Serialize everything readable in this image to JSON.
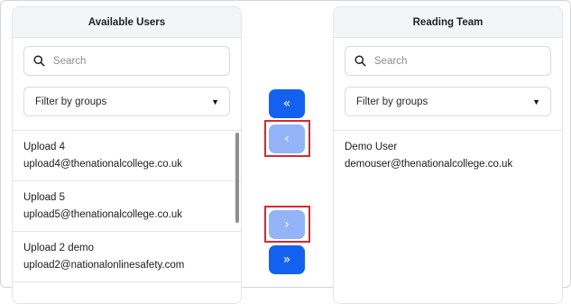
{
  "left_panel": {
    "title": "Available Users",
    "search_placeholder": "Search",
    "filter_label": "Filter by groups",
    "users": [
      {
        "name": "Upload 4",
        "email": "upload4@thenationalcollege.co.uk"
      },
      {
        "name": "Upload 5",
        "email": "upload5@thenationalcollege.co.uk"
      },
      {
        "name": "Upload 2 demo",
        "email": "upload2@nationalonlinesafety.com"
      }
    ]
  },
  "right_panel": {
    "title": "Reading Team",
    "search_placeholder": "Search",
    "filter_label": "Filter by groups",
    "users": [
      {
        "name": "Demo User",
        "email": "demouser@thenationalcollege.co.uk"
      }
    ]
  },
  "transfer_controls": {
    "move_all_left": "«",
    "move_left": "‹",
    "move_right": "›",
    "move_all_right": "»"
  },
  "icons": {
    "search": "search-icon",
    "dropdown": "chevron-down-icon"
  },
  "colors": {
    "button_active": "#1461f0",
    "button_disabled": "#93b4f7",
    "highlight": "#d9282f",
    "header_bg": "#f4f5f7"
  }
}
